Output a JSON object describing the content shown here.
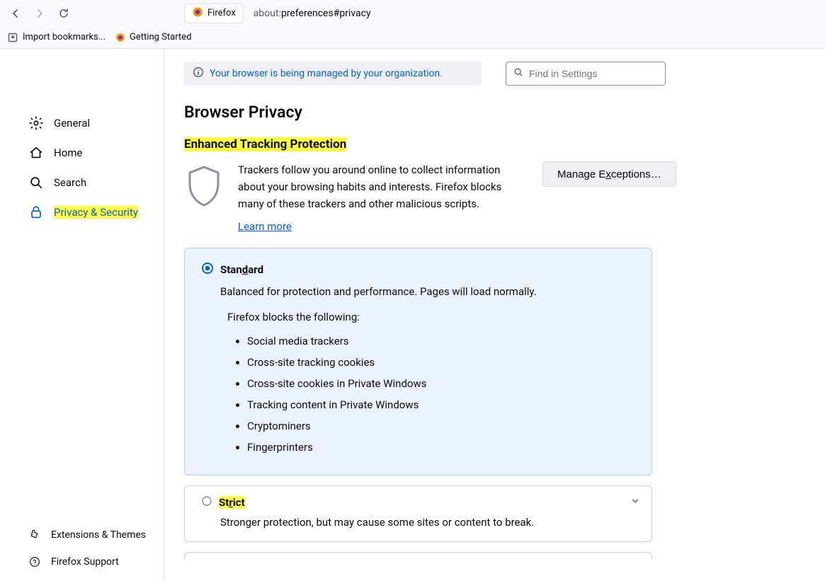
{
  "toolbar": {
    "tab_title": "Firefox",
    "url_scheme": "about:",
    "url_path": "preferences#privacy"
  },
  "bookmarks_bar": {
    "import_label": "Import bookmarks...",
    "getting_started_label": "Getting Started"
  },
  "sidebar": {
    "items": [
      {
        "label": "General"
      },
      {
        "label": "Home"
      },
      {
        "label": "Search"
      },
      {
        "label": "Privacy & Security"
      }
    ],
    "bottom": [
      {
        "label": "Extensions & Themes"
      },
      {
        "label": "Firefox Support"
      }
    ]
  },
  "banner": {
    "text": "Your browser is being managed by your organization."
  },
  "search": {
    "placeholder": "Find in Settings"
  },
  "page": {
    "title": "Browser Privacy",
    "etp_heading": "Enhanced Tracking Protection",
    "etp_desc": "Trackers follow you around online to collect information about your browsing habits and interests. Firefox blocks many of these trackers and other malicious scripts.",
    "learn_more": "Learn more",
    "manage_exceptions": "Manage Exceptions…"
  },
  "standard": {
    "title": "Standard",
    "desc": "Balanced for protection and performance. Pages will load normally.",
    "blocks_intro": "Firefox blocks the following:",
    "items": [
      "Social media trackers",
      "Cross-site tracking cookies",
      "Cross-site cookies in Private Windows",
      "Tracking content in Private Windows",
      "Cryptominers",
      "Fingerprinters"
    ]
  },
  "strict": {
    "title": "Strict",
    "desc": "Stronger protection, but may cause some sites or content to break."
  }
}
